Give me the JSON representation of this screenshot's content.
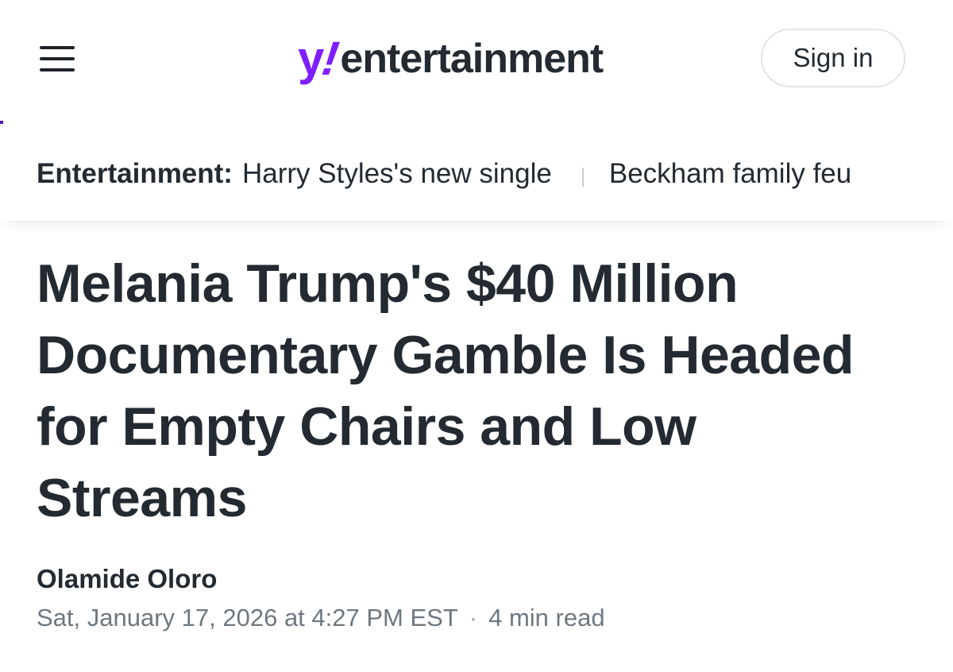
{
  "header": {
    "menu_icon": "hamburger-menu-icon",
    "logo": {
      "y": "y",
      "bang": "!",
      "text": "entertainment",
      "accent_color": "#7e1fff",
      "text_color": "#232a31"
    },
    "signin_label": "Sign in"
  },
  "trending": {
    "label": "Entertainment:",
    "items": [
      "Harry Styles's new single",
      "Beckham family feu"
    ]
  },
  "article": {
    "headline": "Melania Trump's $40 Million Documentary Gamble Is Headed for Empty Chairs and Low Streams",
    "author": "Olamide Oloro",
    "date": "Sat, January 17, 2026 at 4:27 PM EST",
    "separator": "·",
    "read_time": "4 min read"
  }
}
